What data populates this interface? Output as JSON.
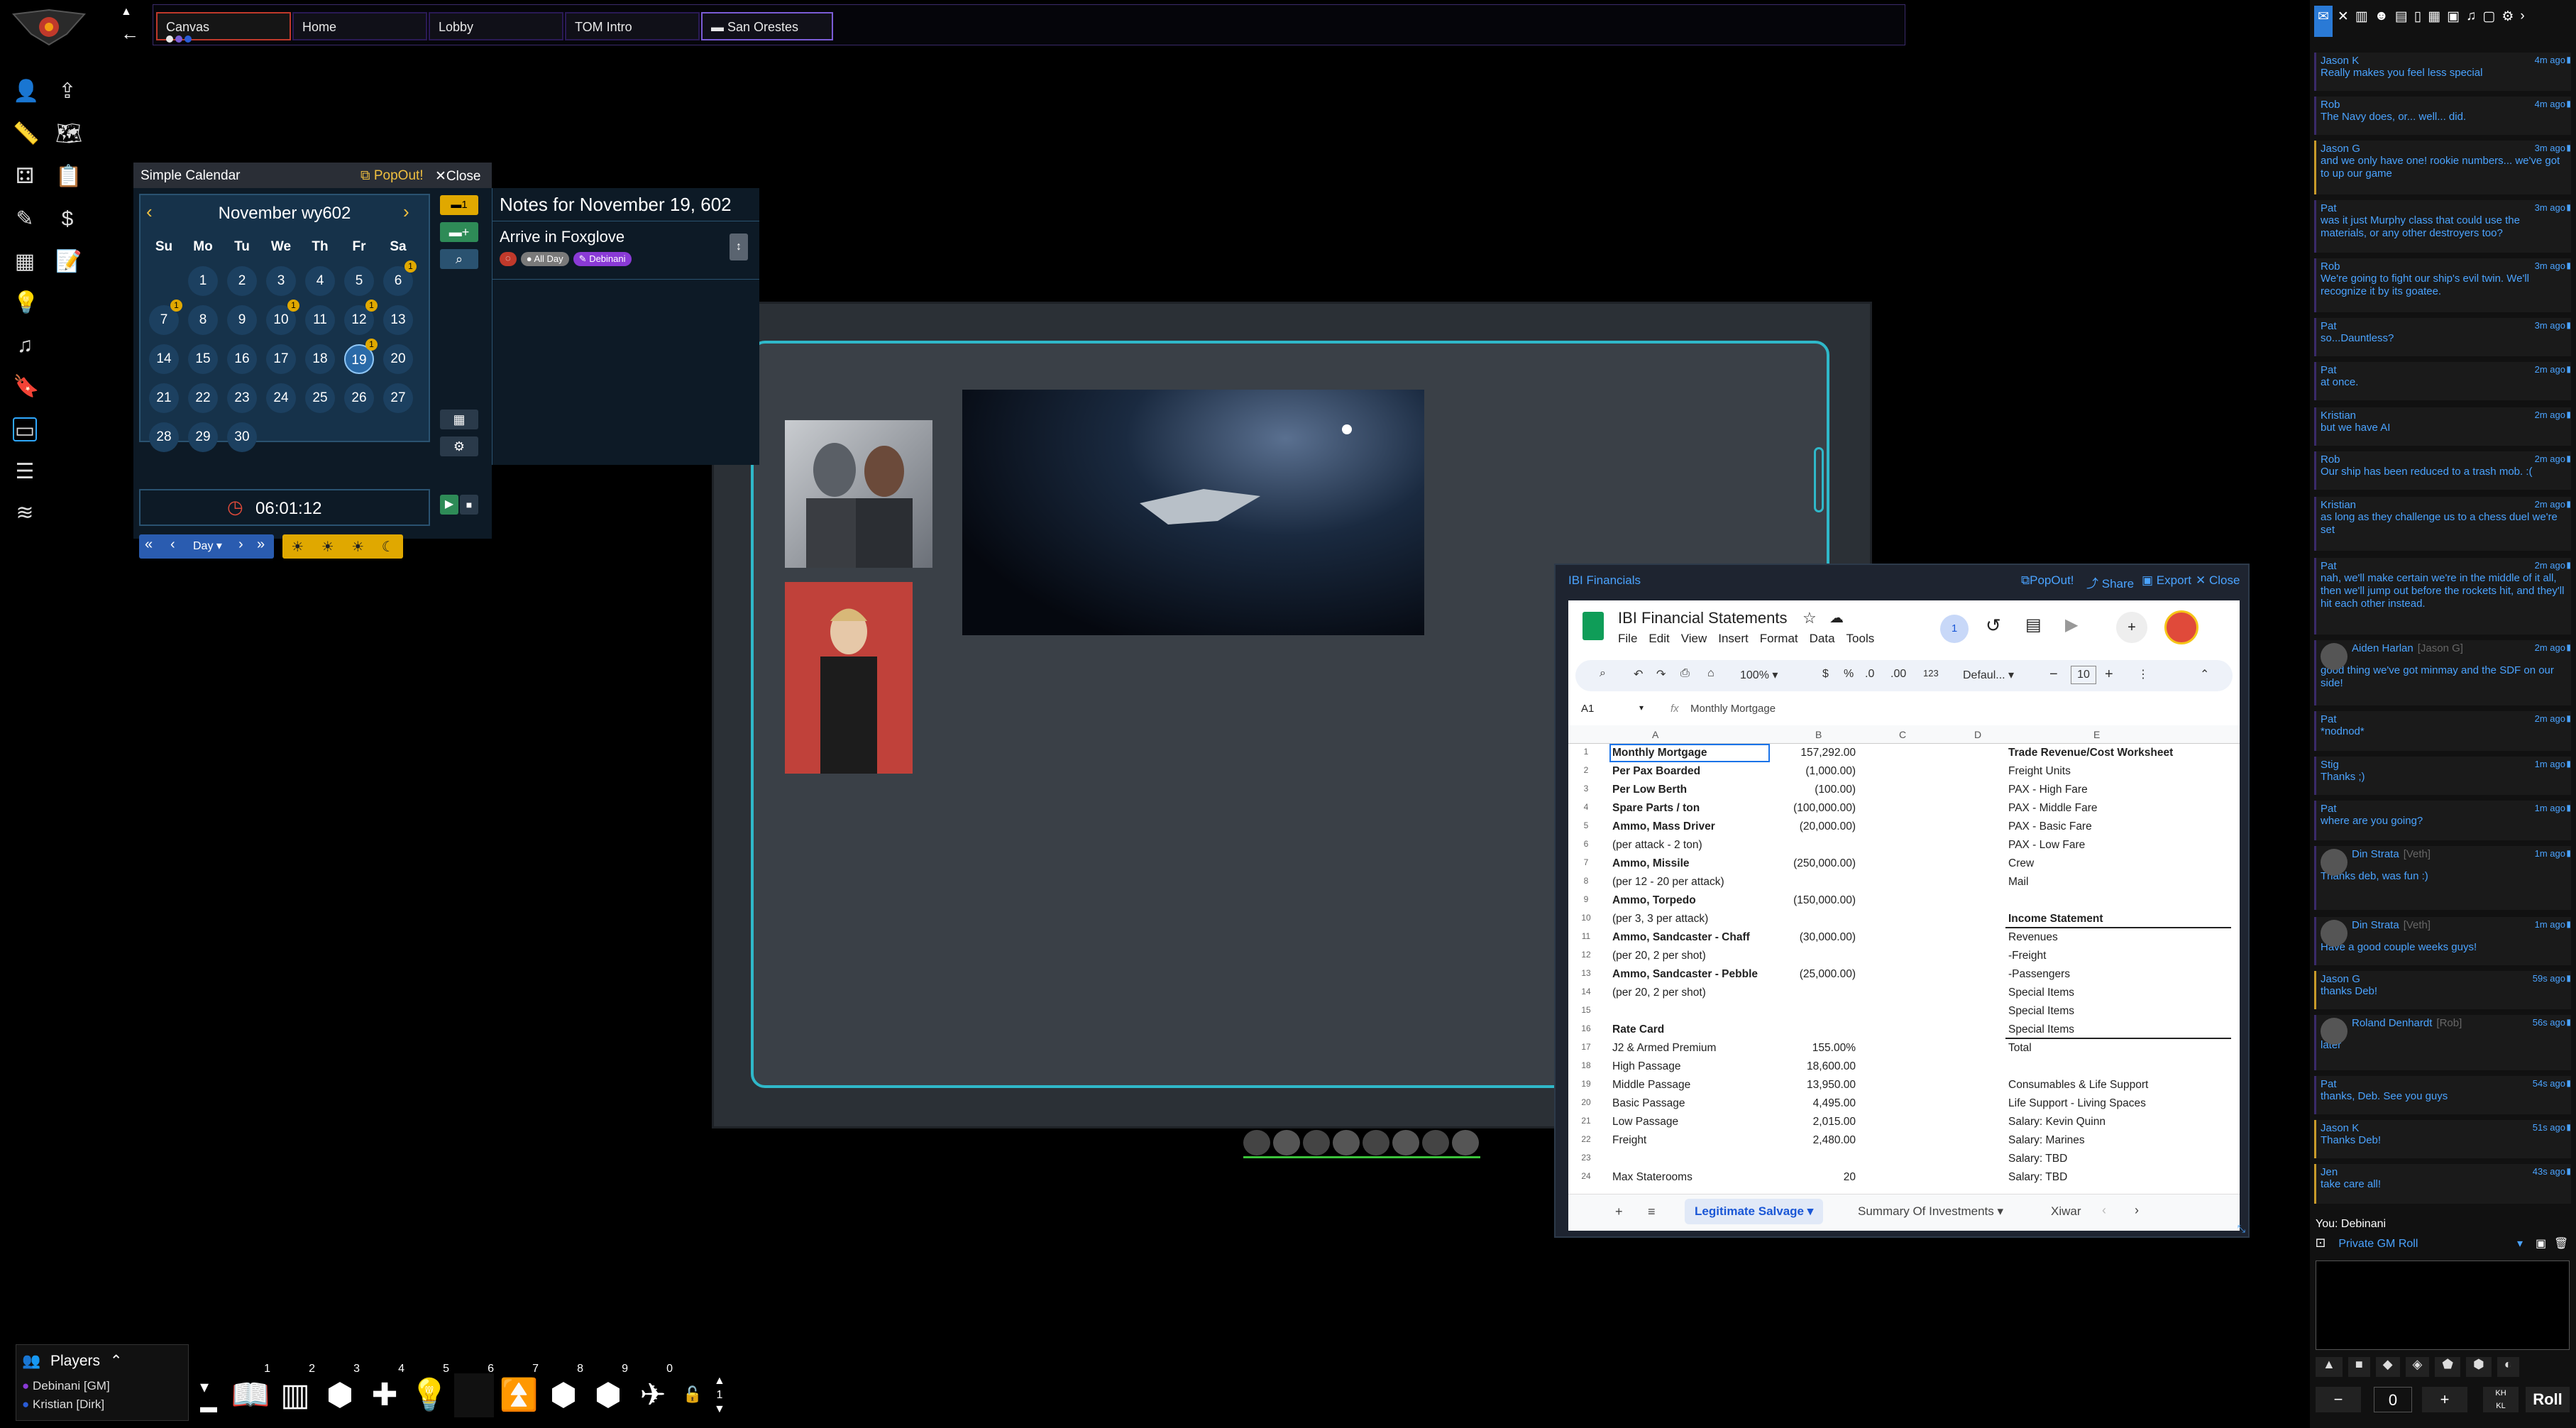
{
  "nav": {
    "tabs": [
      {
        "label": "Canvas",
        "state": "active"
      },
      {
        "label": "Home",
        "state": ""
      },
      {
        "label": "Lobby",
        "state": ""
      },
      {
        "label": "TOM Intro",
        "state": ""
      },
      {
        "label": "San Orestes",
        "state": "viewing"
      }
    ]
  },
  "left_toolbar": [
    "user-icon",
    "upload-icon",
    "ruler-icon",
    "map-icon",
    "cube-icon",
    "clipboard-icon",
    "pencil-icon",
    "dollar-icon",
    "table-icon",
    "document-icon",
    "bulb-icon",
    "music-icon",
    "bookmark-icon",
    "window-icon",
    "list-icon",
    "layers-icon"
  ],
  "calendar": {
    "title": "Simple Calendar",
    "popout": "PopOut!",
    "close": "Close",
    "month": "November wy602",
    "weekdays": [
      "Su",
      "Mo",
      "Tu",
      "We",
      "Th",
      "Fr",
      "Sa"
    ],
    "days": [
      [
        "",
        "1",
        "2",
        "3",
        "4",
        "5",
        "6"
      ],
      [
        "7",
        "8",
        "9",
        "10",
        "11",
        "12",
        "13"
      ],
      [
        "14",
        "15",
        "16",
        "17",
        "18",
        "19",
        "20"
      ],
      [
        "21",
        "22",
        "23",
        "24",
        "25",
        "26",
        "27"
      ],
      [
        "28",
        "29",
        "30",
        "",
        "",
        "",
        ""
      ]
    ],
    "selected_day": "19",
    "badge_count": "1",
    "time": "06:01:12",
    "step_unit": "Day",
    "notes_title": "Notes for November 19, 602",
    "note_name": "Arrive in Foxglove",
    "note_tag_allday": "All Day",
    "note_tag_author": "Debinani",
    "note_count": "1"
  },
  "financials": {
    "window_title": "IBI Financials",
    "popout": "PopOut!",
    "share": "Share",
    "export": "Export",
    "close": "Close",
    "doc_title": "IBI Financial Statements",
    "menu": [
      "File",
      "Edit",
      "View",
      "Insert",
      "Format",
      "Data",
      "Tools"
    ],
    "zoom": "100%",
    "font": "Defaul...",
    "font_size": "10",
    "cell_ref": "A1",
    "formula": "Monthly Mortgage",
    "col_headers": [
      "A",
      "B",
      "C",
      "D",
      "E"
    ],
    "rows": [
      {
        "n": "1",
        "a": "Monthly Mortgage",
        "b": "157,292.00",
        "e": "Trade Revenue/Cost Worksheet",
        "bold": true,
        "ebold": true
      },
      {
        "n": "2",
        "a": "Per Pax Boarded",
        "b": "(1,000.00)",
        "e": "Freight Units",
        "bold": true
      },
      {
        "n": "3",
        "a": "Per Low Berth",
        "b": "(100.00)",
        "e": "PAX - High Fare",
        "bold": true
      },
      {
        "n": "4",
        "a": "Spare Parts / ton",
        "b": "(100,000.00)",
        "e": "PAX - Middle Fare",
        "bold": true
      },
      {
        "n": "5",
        "a": "Ammo, Mass Driver",
        "b": "(20,000.00)",
        "e": "PAX - Basic Fare",
        "bold": true
      },
      {
        "n": "6",
        "a": "(per attack - 2 ton)",
        "b": "",
        "e": "PAX - Low Fare"
      },
      {
        "n": "7",
        "a": "Ammo, Missile",
        "b": "(250,000.00)",
        "e": "Crew",
        "bold": true
      },
      {
        "n": "8",
        "a": "(per 12 - 20 per attack)",
        "b": "",
        "e": "Mail"
      },
      {
        "n": "9",
        "a": "Ammo, Torpedo",
        "b": "(150,000.00)",
        "e": "",
        "bold": true
      },
      {
        "n": "10",
        "a": "(per 3, 3 per attack)",
        "b": "",
        "e": "Income Statement",
        "ebold": true
      },
      {
        "n": "11",
        "a": "Ammo, Sandcaster - Chaff",
        "b": "(30,000.00)",
        "e": "Revenues",
        "bold": true
      },
      {
        "n": "12",
        "a": "(per 20, 2 per shot)",
        "b": "",
        "e": "-Freight"
      },
      {
        "n": "13",
        "a": "Ammo, Sandcaster - Pebble",
        "b": "(25,000.00)",
        "e": "-Passengers",
        "bold": true
      },
      {
        "n": "14",
        "a": "(per 20, 2 per shot)",
        "b": "",
        "e": "Special Items"
      },
      {
        "n": "15",
        "a": "",
        "b": "",
        "e": "Special Items"
      },
      {
        "n": "16",
        "a": "Rate Card",
        "b": "",
        "e": "Special Items",
        "bold": true
      },
      {
        "n": "17",
        "a": "J2 & Armed Premium",
        "b": "155.00%",
        "e": "Total"
      },
      {
        "n": "18",
        "a": "High Passage",
        "b": "18,600.00",
        "e": ""
      },
      {
        "n": "19",
        "a": "Middle Passage",
        "b": "13,950.00",
        "e": "Consumables & Life Support"
      },
      {
        "n": "20",
        "a": "Basic Passage",
        "b": "4,495.00",
        "e": "Life Support - Living Spaces"
      },
      {
        "n": "21",
        "a": "Low Passage",
        "b": "2,015.00",
        "e": "Salary: Kevin Quinn"
      },
      {
        "n": "22",
        "a": "Freight",
        "b": "2,480.00",
        "e": "Salary: Marines"
      },
      {
        "n": "23",
        "a": "",
        "b": "",
        "e": "Salary: TBD"
      },
      {
        "n": "24",
        "a": "Max Staterooms",
        "b": "20",
        "e": "Salary: TBD"
      }
    ],
    "sheet_tabs": [
      "Legitimate Salvage",
      "Summary Of Investments",
      "Xiwar"
    ]
  },
  "chat": {
    "messages": [
      {
        "who": "Jason K",
        "time": "4m ago",
        "text": "Really makes you feel less special"
      },
      {
        "who": "Rob",
        "time": "4m ago",
        "text": "The Navy does, or... well... did."
      },
      {
        "who": "Jason G",
        "time": "3m ago",
        "text": "and we only have one! rookie numbers... we've got to up our game"
      },
      {
        "who": "Pat",
        "time": "3m ago",
        "text": "was it just Murphy class that could use the materials, or any other destroyers too?"
      },
      {
        "who": "Rob",
        "time": "3m ago",
        "text": "We're going to fight our ship's evil twin. We'll recognize it by its goatee."
      },
      {
        "who": "Pat",
        "time": "3m ago",
        "text": "so...Dauntless?"
      },
      {
        "who": "Pat",
        "time": "2m ago",
        "text": "at once."
      },
      {
        "who": "Kristian",
        "time": "2m ago",
        "text": "but we have AI"
      },
      {
        "who": "Rob",
        "time": "2m ago",
        "text": "Our ship has been reduced to a trash mob. :("
      },
      {
        "who": "Kristian",
        "time": "2m ago",
        "text": "as long as they challenge us to a chess duel we're set"
      },
      {
        "who": "Pat",
        "time": "2m ago",
        "text": "nah, we'll make certain we're in the middle of it all, then we'll jump out before the rockets hit, and they'll hit each other instead."
      },
      {
        "who": "Aiden Harlan",
        "sub": "[Jason G]",
        "time": "2m ago",
        "text": "good thing we've got minmay and the SDF on our side!"
      },
      {
        "who": "Pat",
        "time": "2m ago",
        "text": "*nodnod*"
      },
      {
        "who": "Stig",
        "time": "1m ago",
        "text": "Thanks ;)"
      },
      {
        "who": "Pat",
        "time": "1m ago",
        "text": "where are you going?"
      },
      {
        "who": "Din Strata",
        "sub": "[Veth]",
        "time": "1m ago",
        "text": "Thanks deb, was fun :)"
      },
      {
        "who": "Din Strata",
        "sub": "[Veth]",
        "time": "1m ago",
        "text": "Have a good couple weeks guys!"
      },
      {
        "who": "Jason G",
        "time": "59s ago",
        "text": "thanks Deb!"
      },
      {
        "who": "Roland Denhardt",
        "sub": "[Rob]",
        "time": "56s ago",
        "text": "later"
      },
      {
        "who": "Pat",
        "time": "54s ago",
        "text": "thanks, Deb. See you guys"
      },
      {
        "who": "Jason K",
        "time": "51s ago",
        "text": "Thanks Deb!"
      },
      {
        "who": "Jen",
        "time": "43s ago",
        "text": "take care all!"
      }
    ],
    "you": "You: Debinani",
    "roll_mode": "Private GM Roll",
    "dice_count": "0",
    "roll_button": "Roll"
  },
  "players": {
    "title": "Players",
    "list": [
      "Debinani [GM]",
      "Kristian [Dirk]"
    ]
  },
  "hotbar": {
    "slots": [
      "1",
      "2",
      "3",
      "4",
      "5",
      "6",
      "7",
      "8",
      "9",
      "0"
    ],
    "page": "1"
  }
}
